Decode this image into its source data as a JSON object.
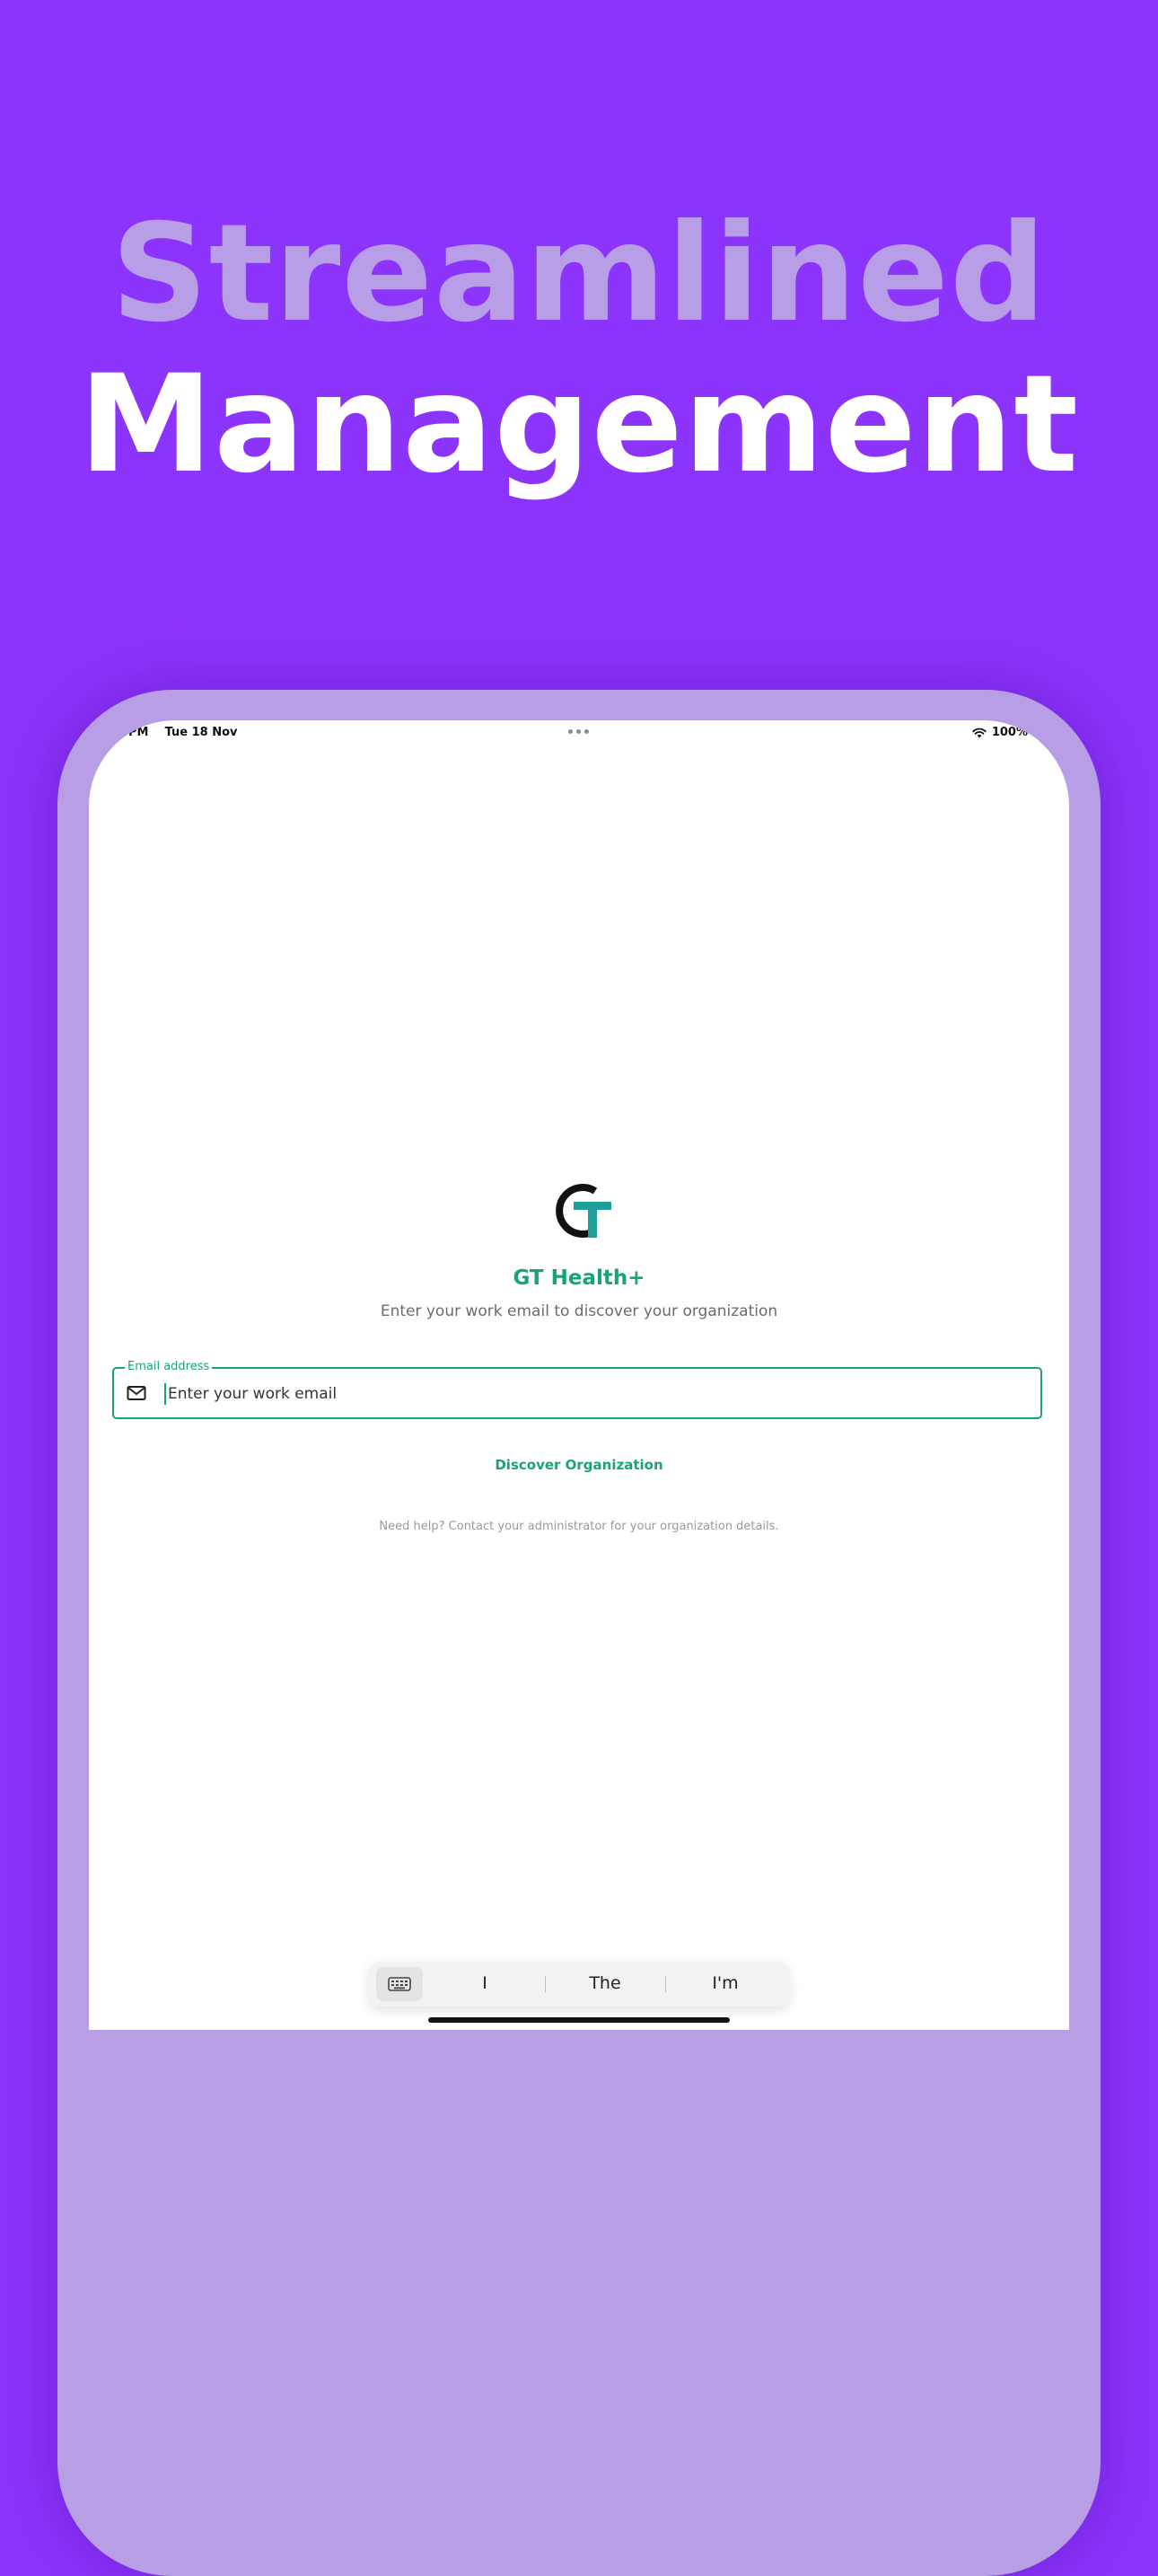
{
  "headline": {
    "line1": "Streamlined",
    "line2": "Management"
  },
  "status_bar": {
    "time": "PM",
    "date": "Tue 18 Nov",
    "battery": "100%"
  },
  "app": {
    "name": "GT Health+",
    "subtitle": "Enter your work email to discover your organization"
  },
  "email_field": {
    "label": "Email address",
    "placeholder": "Enter your work email",
    "value": ""
  },
  "discover_button": {
    "label": "Discover Organization"
  },
  "help": {
    "text": "Need help? Contact your administrator for your organization details."
  },
  "keyboard_suggestions": [
    "I",
    "The",
    "I'm"
  ],
  "colors": {
    "background": "#8c33fc",
    "frame": "#b89fe5",
    "accent": "#1aa37a",
    "logo_dark": "#111111",
    "logo_teal": "#1f9f9a"
  }
}
